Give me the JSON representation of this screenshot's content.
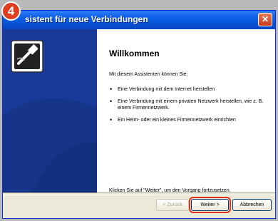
{
  "step_badge": "4",
  "window": {
    "title": "sistent für neue Verbindungen",
    "close_glyph": "✕"
  },
  "content": {
    "heading": "Willkommen",
    "intro": "Mit diesem Assistenten können Sie:",
    "bullets": [
      "Eine Verbindung mit dem Internet herstellen",
      "Eine Verbindung mit einem privaten Netzwerk herstellen, wie z. B. einem Firmennetzwerk.",
      "Ein Heim- oder ein kleines Firmennetzwerk einrichten"
    ],
    "footer": "Klicken Sie auf \"Weiter\", um den Vorgang fortzusetzen."
  },
  "buttons": {
    "back_label": "< Zurück",
    "next_label": "Weiter >",
    "cancel_label": "Abbrechen"
  },
  "colors": {
    "title_bar": "#0a5fe6",
    "left_panel": "#1a3a9a",
    "highlight": "#e0311c"
  },
  "icons": {
    "wizard": "network-cable-plug-icon"
  }
}
